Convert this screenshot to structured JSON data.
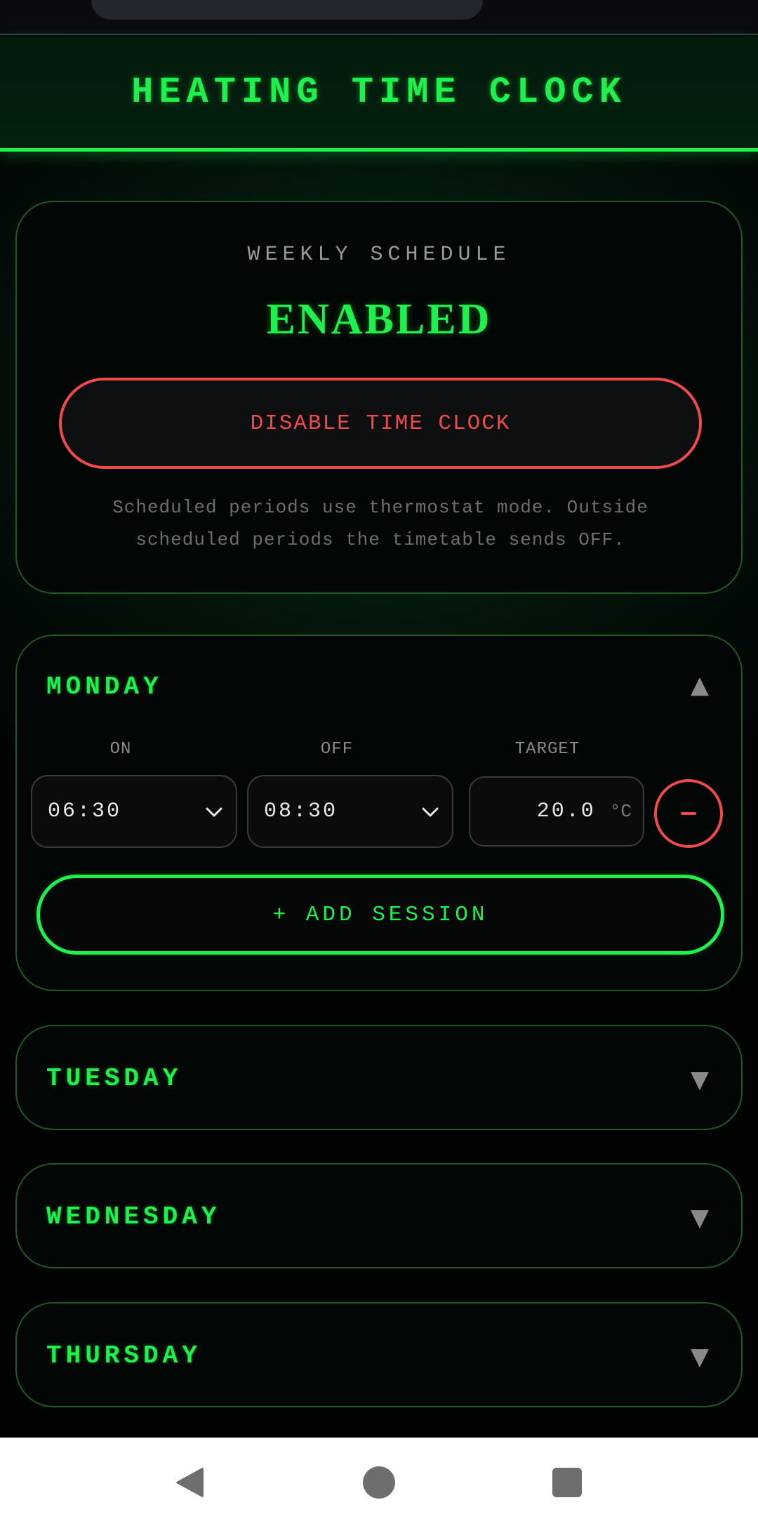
{
  "header": {
    "title": "HEATING TIME CLOCK"
  },
  "schedule": {
    "label": "WEEKLY SCHEDULE",
    "state": "ENABLED",
    "disable_button": "DISABLE TIME CLOCK",
    "note": "Scheduled periods use thermostat mode. Outside scheduled periods the timetable sends OFF."
  },
  "monday": {
    "name": "MONDAY",
    "expanded": true,
    "caret": "▲",
    "columns": {
      "on": "ON",
      "off": "OFF",
      "target": "TARGET"
    },
    "sessions": [
      {
        "on": "06:30",
        "off": "08:30",
        "target": "20.0",
        "unit": "°C"
      }
    ],
    "add_session": "+ ADD SESSION"
  },
  "days": [
    {
      "name": "TUESDAY",
      "caret": "▼"
    },
    {
      "name": "WEDNESDAY",
      "caret": "▼"
    },
    {
      "name": "THURSDAY",
      "caret": "▼"
    }
  ],
  "colors": {
    "accent_green": "#1ef04e",
    "danger_red": "#f04a4a",
    "background": "#020705"
  },
  "icons": {
    "collapse": "chevron-up-icon",
    "expand": "chevron-down-icon",
    "remove": "minus-icon",
    "nav_back": "back-triangle-icon",
    "nav_home": "home-circle-icon",
    "nav_recents": "recents-square-icon"
  }
}
